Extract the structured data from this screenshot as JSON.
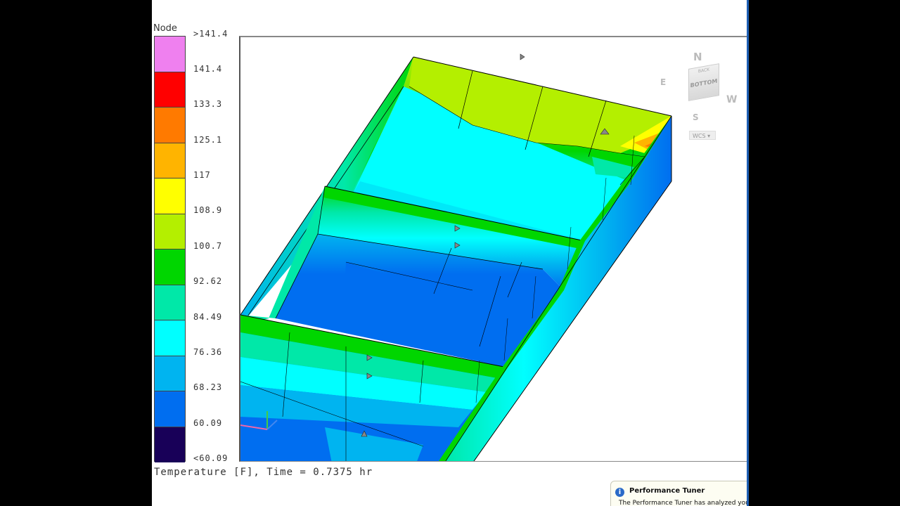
{
  "legend": {
    "title": "Node",
    "labels": [
      ">141.4",
      "141.4",
      "133.3",
      "125.1",
      "117",
      "108.9",
      "100.7",
      "92.62",
      "84.49",
      "76.36",
      "68.23",
      "60.09",
      "<60.09"
    ],
    "colors": [
      "#ef80ef",
      "#ff0000",
      "#ff7a00",
      "#ffb400",
      "#ffff00",
      "#b4ef00",
      "#00d600",
      "#00e8a8",
      "#00ffff",
      "#00b4f0",
      "#006ef0",
      "#180058"
    ]
  },
  "caption": "Temperature [F], Time = 0.7375 hr",
  "viewcube": {
    "north": "N",
    "east": "E",
    "west": "W",
    "south": "S",
    "back": "BACK",
    "bottom": "BOTTOM",
    "wcs": "WCS"
  },
  "notification": {
    "title": "Performance Tuner",
    "message": "The Performance Tuner has analyzed your d"
  }
}
